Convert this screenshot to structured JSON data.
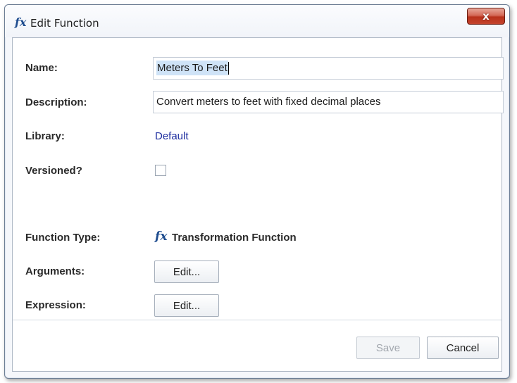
{
  "window": {
    "title": "Edit Function",
    "title_icon": "fx-icon",
    "close_label": "x"
  },
  "form": {
    "name_label": "Name:",
    "name_value": "Meters To Feet",
    "description_label": "Description:",
    "description_value": "Convert meters to feet with fixed decimal places",
    "library_label": "Library:",
    "library_value": "Default",
    "versioned_label": "Versioned?",
    "versioned_checked": false,
    "function_type_label": "Function Type:",
    "function_type_icon": "fx-icon",
    "function_type_value": "Transformation Function",
    "arguments_label": "Arguments:",
    "arguments_button": "Edit...",
    "expression_label": "Expression:",
    "expression_button": "Edit..."
  },
  "footer": {
    "save_label": "Save",
    "save_enabled": false,
    "cancel_label": "Cancel"
  },
  "colors": {
    "fx_icon": "#1f4d8f",
    "link": "#1f2fa0",
    "close_button": "#c4432c"
  }
}
